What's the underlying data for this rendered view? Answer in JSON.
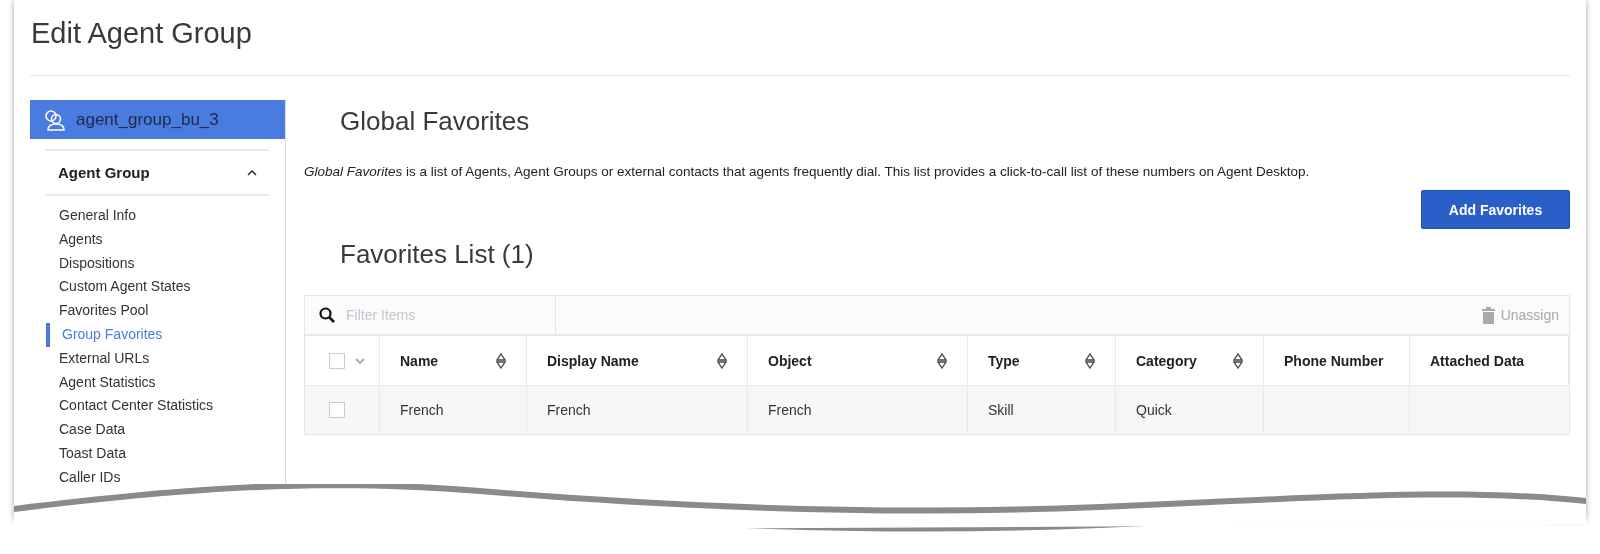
{
  "page_title": "Edit Agent Group",
  "sidebar": {
    "group_name": "agent_group_bu_3",
    "section": {
      "title": "Agent Group",
      "expanded": true
    },
    "items": [
      {
        "label": "General Info",
        "selected": false
      },
      {
        "label": "Agents",
        "selected": false
      },
      {
        "label": "Dispositions",
        "selected": false
      },
      {
        "label": "Custom Agent States",
        "selected": false
      },
      {
        "label": "Favorites Pool",
        "selected": false
      },
      {
        "label": "Group Favorites",
        "selected": true
      },
      {
        "label": "External URLs",
        "selected": false
      },
      {
        "label": "Agent Statistics",
        "selected": false
      },
      {
        "label": "Contact Center Statistics",
        "selected": false
      },
      {
        "label": "Case Data",
        "selected": false
      },
      {
        "label": "Toast Data",
        "selected": false
      },
      {
        "label": "Caller IDs",
        "selected": false
      }
    ]
  },
  "main": {
    "title": "Global Favorites",
    "description": "*Global Favorites* is a list of Agents, Agent Groups or external contacts that agents frequently dial. This list provides a click-to-call list of these numbers on Agent Desktop.",
    "add_button": "Add Favorites",
    "list_title": "Favorites List (1)",
    "filter": {
      "placeholder": "Filter Items"
    },
    "unassign_button": {
      "label": "Unassign",
      "disabled": true
    },
    "table": {
      "select_all": {
        "checked": false
      },
      "columns": [
        {
          "label": "Name",
          "sortable": true
        },
        {
          "label": "Display Name",
          "sortable": true
        },
        {
          "label": "Object",
          "sortable": true
        },
        {
          "label": "Type",
          "sortable": true
        },
        {
          "label": "Category",
          "sortable": true
        },
        {
          "label": "Phone Number",
          "sortable": false
        },
        {
          "label": "Attached Data",
          "sortable": false
        }
      ],
      "rows": [
        {
          "checked": false,
          "cells": [
            "French",
            "French",
            "French",
            "Skill",
            "Quick",
            "",
            ""
          ]
        }
      ]
    }
  }
}
